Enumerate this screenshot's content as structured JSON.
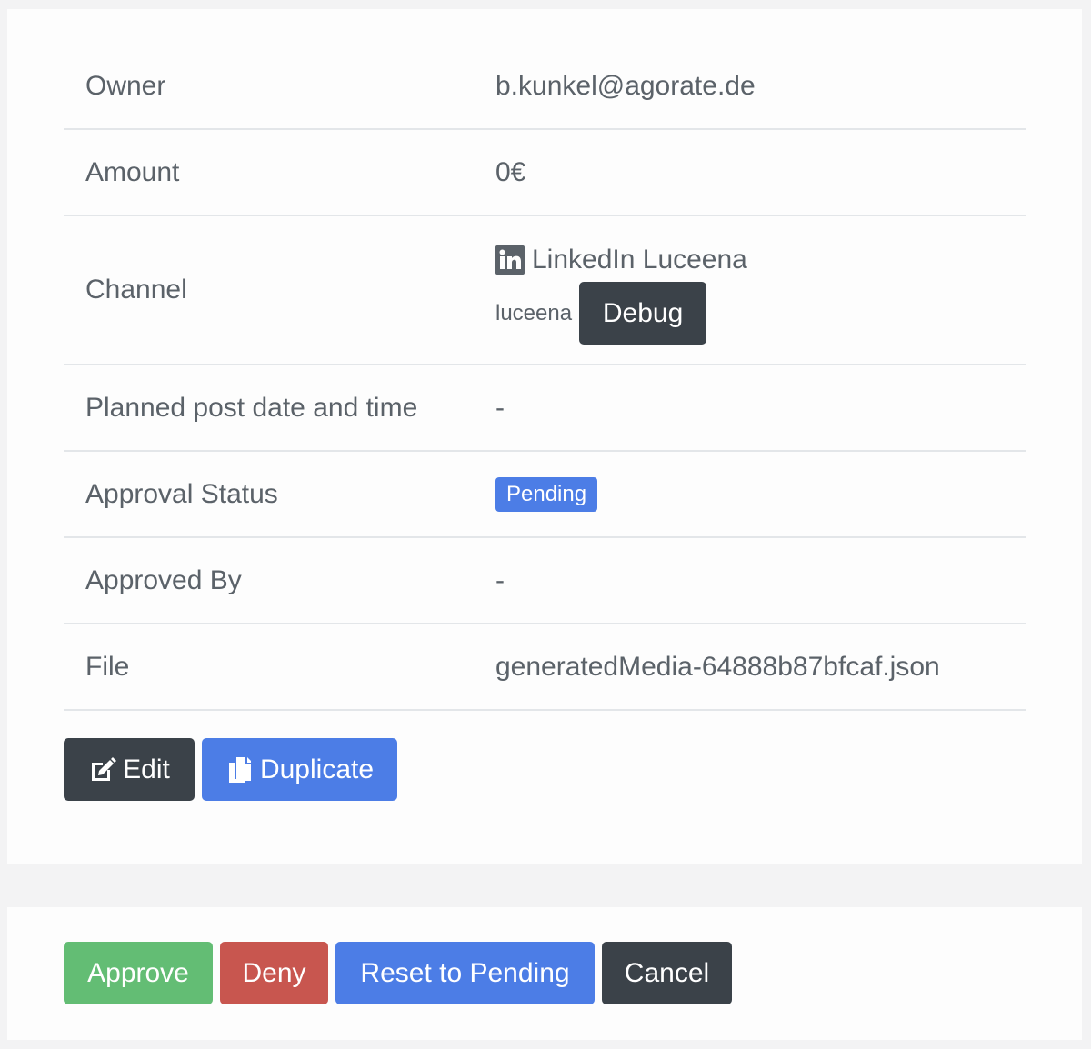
{
  "details": {
    "owner": {
      "label": "Owner",
      "value": "b.kunkel@agorate.de"
    },
    "amount": {
      "label": "Amount",
      "value": "0€"
    },
    "channel": {
      "label": "Channel",
      "icon": "linkedin-icon",
      "name": "LinkedIn Luceena",
      "handle": "luceena",
      "debug_label": "Debug"
    },
    "planned_post": {
      "label": "Planned post date and time",
      "value": "-"
    },
    "approval_status": {
      "label": "Approval Status",
      "badge": "Pending",
      "badge_color": "#4c7de6"
    },
    "approved_by": {
      "label": "Approved By",
      "value": "-"
    },
    "file": {
      "label": "File",
      "value": "generatedMedia-64888b87bfcaf.json"
    }
  },
  "file_actions": {
    "edit_label": "Edit",
    "edit_icon": "edit-icon",
    "duplicate_label": "Duplicate",
    "duplicate_icon": "copy-icon"
  },
  "approval_actions": {
    "approve_label": "Approve",
    "deny_label": "Deny",
    "reset_label": "Reset to Pending",
    "cancel_label": "Cancel"
  },
  "colors": {
    "dark": "#3b4249",
    "primary": "#4c7de6",
    "success": "#63bd74",
    "danger": "#c8564f",
    "text": "#5b6269"
  }
}
